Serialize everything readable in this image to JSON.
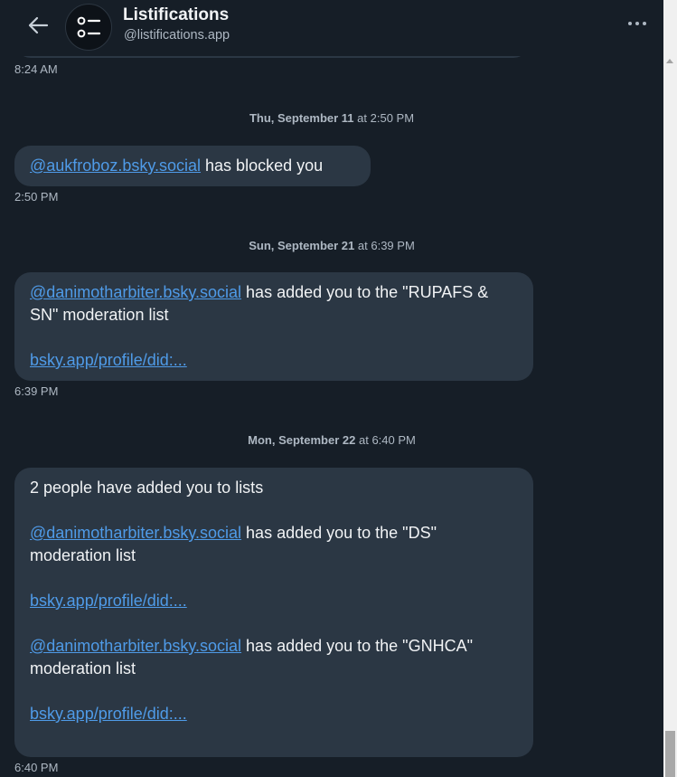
{
  "header": {
    "back_icon": "arrow-left-icon",
    "avatar_icon": "list-icon",
    "title": "Listifications",
    "handle": "@listifications.app",
    "more_icon": "ellipsis-icon"
  },
  "colors": {
    "background": "#161e27",
    "bubble": "#2b3744",
    "link": "#4f9be8",
    "muted_text": "#aeb8c3"
  },
  "messages": {
    "m0": {
      "time": "8:24 AM"
    },
    "d1": {
      "date": "Thu, September 11",
      "connector": "at",
      "time": "2:50 PM"
    },
    "m1": {
      "handle": "@aukfroboz.bsky.social",
      "text": " has blocked you",
      "time": "2:50 PM"
    },
    "d2": {
      "date": "Sun, September 21",
      "connector": "at",
      "time": "6:39 PM"
    },
    "m2": {
      "handle": "@danimotharbiter.bsky.social",
      "text": " has added you to the \"RUPAFS & SN\" moderation list",
      "link": "bsky.app/profile/did:...",
      "time": "6:39 PM"
    },
    "d3": {
      "date": "Mon, September 22",
      "connector": "at",
      "time": "6:40 PM"
    },
    "m3": {
      "intro": "2 people have added you to lists",
      "entry1_handle": "@danimotharbiter.bsky.social",
      "entry1_text": " has added you to the \"DS\" moderation list",
      "entry1_link": "bsky.app/profile/did:...",
      "entry2_handle": "@danimotharbiter.bsky.social",
      "entry2_text": " has added you to the \"GNHCA\" moderation list",
      "entry2_link": "bsky.app/profile/did:...",
      "time": "6:40 PM"
    }
  }
}
